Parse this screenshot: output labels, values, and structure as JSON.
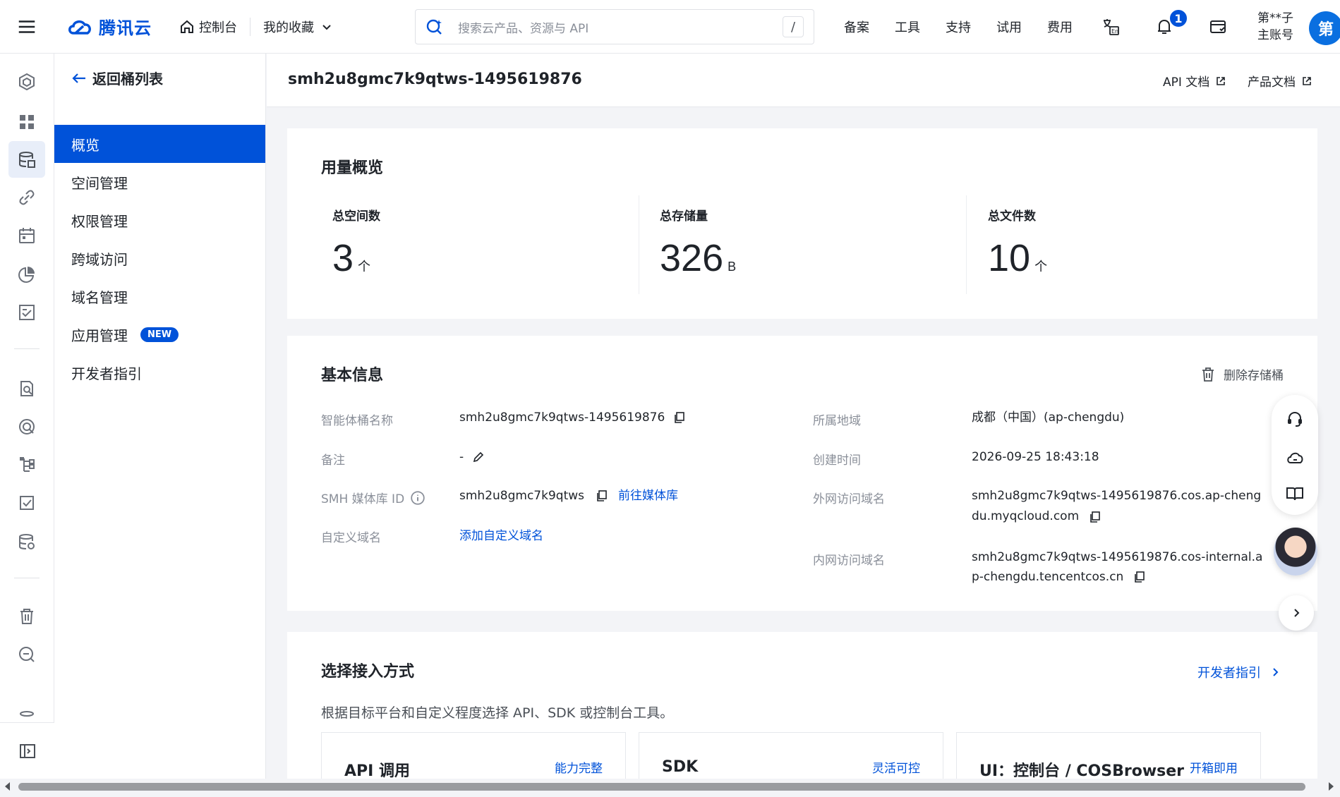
{
  "topbar": {
    "brand": "腾讯云",
    "console": "控制台",
    "favorites": "我的收藏",
    "search_placeholder": "搜索云产品、资源与 API",
    "search_shortcut": "/",
    "links": [
      "备案",
      "工具",
      "支持",
      "试用",
      "费用"
    ],
    "notification_count": "1",
    "account_line1": "第**子",
    "account_line2": "主账号",
    "avatar_text": "第"
  },
  "sidebar": {
    "back_label": "返回桶列表",
    "items": [
      {
        "label": "概览",
        "active": true
      },
      {
        "label": "空间管理"
      },
      {
        "label": "权限管理"
      },
      {
        "label": "跨域访问"
      },
      {
        "label": "域名管理"
      },
      {
        "label": "应用管理",
        "badge": "NEW"
      },
      {
        "label": "开发者指引"
      }
    ]
  },
  "header": {
    "title": "smh2u8gmc7k9qtws-1495619876",
    "api_doc": "API 文档",
    "product_doc": "产品文档"
  },
  "usage": {
    "title": "用量概览",
    "stats": [
      {
        "label": "总空间数",
        "value": "3",
        "unit": "个"
      },
      {
        "label": "总存储量",
        "value": "326",
        "unit": "B"
      },
      {
        "label": "总文件数",
        "value": "10",
        "unit": "个"
      }
    ]
  },
  "basic": {
    "title": "基本信息",
    "delete_label": "删除存储桶",
    "name_label": "智能体桶名称",
    "name_value": "smh2u8gmc7k9qtws-1495619876",
    "remark_label": "备注",
    "remark_value": "-",
    "smh_label": "SMH 媒体库 ID",
    "smh_value": "smh2u8gmc7k9qtws",
    "smh_link": "前往媒体库",
    "custom_domain_label": "自定义域名",
    "custom_domain_link": "添加自定义域名",
    "region_label": "所属地域",
    "region_value": "成都（中国）(ap-chengdu)",
    "created_label": "创建时间",
    "created_value": "2026-09-25 18:43:18",
    "public_label": "外网访问域名",
    "public_line1": "smh2u8gmc7k9qtws-1495619876.cos.ap-cheng",
    "public_line2": "du.myqcloud.com",
    "internal_label": "内网访问域名",
    "internal_line1": "smh2u8gmc7k9qtws-1495619876.cos-internal.a",
    "internal_line2": "p-chengdu.tencentcos.cn"
  },
  "access": {
    "title": "选择接入方式",
    "dev_guide": "开发者指引",
    "desc": "根据目标平台和自定义程度选择 API、SDK 或控制台工具。",
    "options": [
      {
        "title": "API 调用",
        "tag": "能力完整"
      },
      {
        "title": "SDK",
        "tag": "灵活可控"
      },
      {
        "title": "UI：控制台 / COSBrowser",
        "tag": "开箱即用"
      }
    ]
  }
}
